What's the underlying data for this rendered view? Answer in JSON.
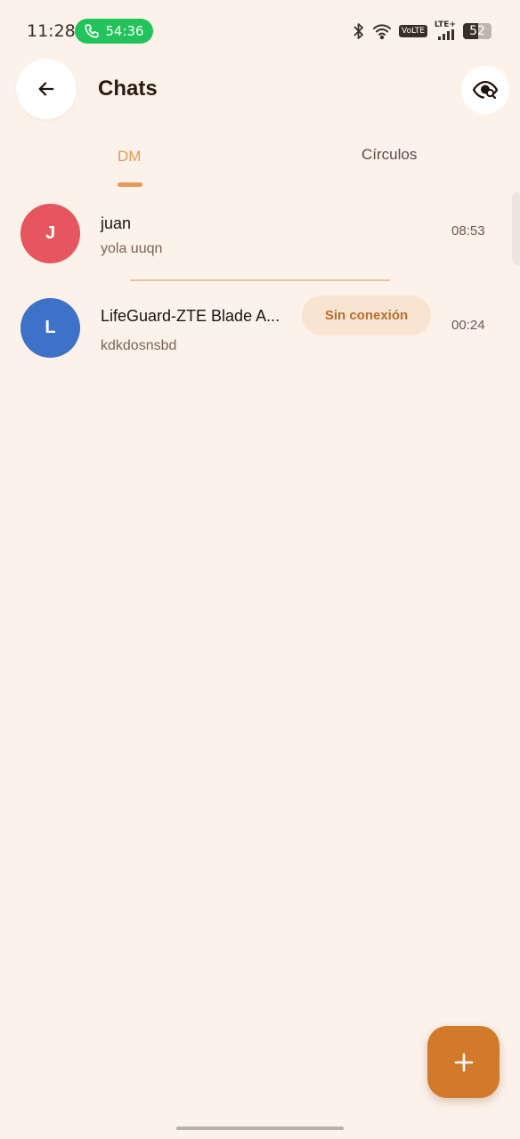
{
  "status_bar": {
    "time": "11:28",
    "call_duration": "54:36",
    "volte": "VoLTE",
    "lte": "LTE+",
    "battery": "52",
    "battery_level": 0.52
  },
  "header": {
    "title": "Chats",
    "back_icon": "arrow-left-icon",
    "action_icon": "eye-search-icon"
  },
  "tabs": [
    {
      "label": "DM",
      "active": true
    },
    {
      "label": "Círculos",
      "active": false
    }
  ],
  "chats": [
    {
      "initial": "J",
      "name": "juan",
      "last_message": "yola uuqn",
      "time": "08:53",
      "avatar_color": "#e5565f"
    },
    {
      "initial": "L",
      "name": "LifeGuard-ZTE Blade A...",
      "last_message": "kdkdosnsbd",
      "time": "00:24",
      "avatar_color": "#3e72c8",
      "badge": "Sin conexión"
    }
  ],
  "fab": {
    "icon": "plus-icon"
  },
  "colors": {
    "background": "#fcf2ea",
    "accent": "#e79a55",
    "fab": "#d27a2a",
    "badge_bg": "#f9e4d2",
    "badge_text": "#b86f2c"
  }
}
